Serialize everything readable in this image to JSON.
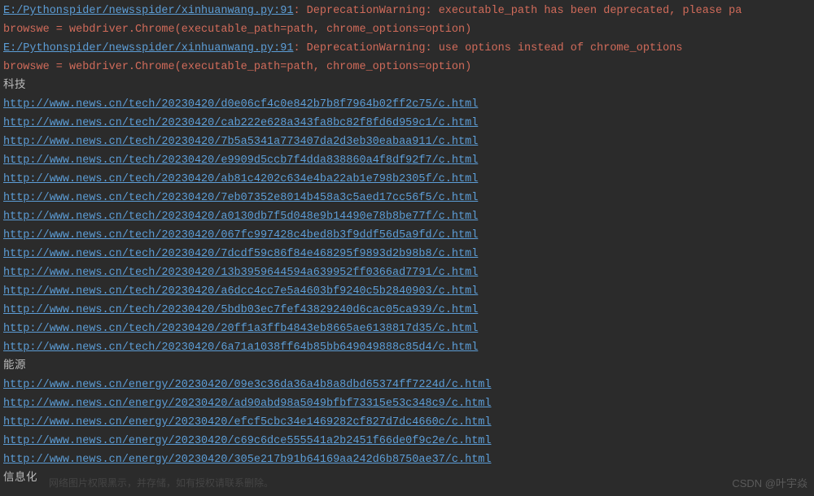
{
  "warnings": [
    {
      "path": "E:/Pythonspider/newsspider/xinhuanwang.py:91",
      "sep": ": ",
      "msg": "DeprecationWarning: executable_path has been deprecated, please pa",
      "code": "  browswe = webdriver.Chrome(executable_path=path, chrome_options=option)"
    },
    {
      "path": "E:/Pythonspider/newsspider/xinhuanwang.py:91",
      "sep": ": ",
      "msg": "DeprecationWarning: use options instead of chrome_options",
      "code": "  browswe = webdriver.Chrome(executable_path=path, chrome_options=option)"
    }
  ],
  "sections": [
    {
      "title": "科技",
      "urls": [
        "http://www.news.cn/tech/20230420/d0e06cf4c0e842b7b8f7964b02ff2c75/c.html",
        "http://www.news.cn/tech/20230420/cab222e628a343fa8bc82f8fd6d959c1/c.html",
        "http://www.news.cn/tech/20230420/7b5a5341a773407da2d3eb30eabaa911/c.html",
        "http://www.news.cn/tech/20230420/e9909d5ccb7f4dda838860a4f8df92f7/c.html",
        "http://www.news.cn/tech/20230420/ab81c4202c634e4ba22ab1e798b2305f/c.html",
        "http://www.news.cn/tech/20230420/7eb07352e8014b458a3c5aed17cc56f5/c.html",
        "http://www.news.cn/tech/20230420/a0130db7f5d048e9b14490e78b8be77f/c.html",
        "http://www.news.cn/tech/20230420/067fc997428c4bed8b3f9ddf56d5a9fd/c.html",
        "http://www.news.cn/tech/20230420/7dcdf59c86f84e468295f9893d2b98b8/c.html",
        "http://www.news.cn/tech/20230420/13b3959644594a639952ff0366ad7791/c.html",
        "http://www.news.cn/tech/20230420/a6dcc4cc7e5a4603bf9240c5b2840903/c.html",
        "http://www.news.cn/tech/20230420/5bdb03ec7fef43829240d6cac05ca939/c.html",
        "http://www.news.cn/tech/20230420/20ff1a3ffb4843eb8665ae6138817d35/c.html",
        "http://www.news.cn/tech/20230420/6a71a1038ff64b85bb649049888c85d4/c.html"
      ]
    },
    {
      "title": "能源",
      "urls": [
        "http://www.news.cn/energy/20230420/09e3c36da36a4b8a8dbd65374ff7224d/c.html",
        "http://www.news.cn/energy/20230420/ad90abd98a5049bfbf73315e53c348c9/c.html",
        "http://www.news.cn/energy/20230420/efcf5cbc34e1469282cf827d7dc4660c/c.html",
        "http://www.news.cn/energy/20230420/c69c6dce555541a2b2451f66de0f9c2e/c.html",
        "http://www.news.cn/energy/20230420/305e217b91b64169aa242d6b8750ae37/c.html"
      ]
    },
    {
      "title": "信息化",
      "urls": []
    }
  ],
  "watermark": "CSDN @叶宇焱",
  "ghost": "网络图片权限黑示，并存储，如有授权请联系删除。"
}
